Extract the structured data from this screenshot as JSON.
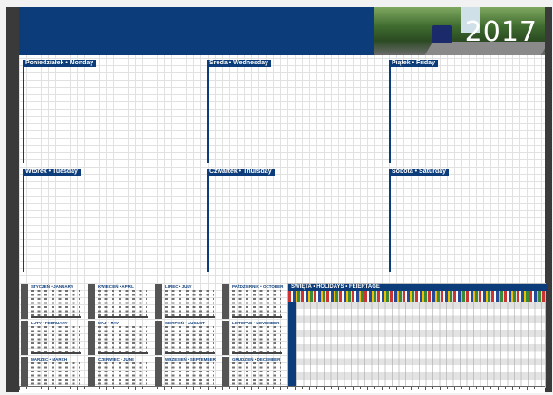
{
  "year": "2017",
  "days": {
    "mon": "Poniedziałek • Monday",
    "wed": "Środa • Wednesday",
    "fri": "Piątek • Friday",
    "tue": "Wtorek • Tuesday",
    "thu": "Czwartek • Thursday",
    "sat": "Sobota • Saturday"
  },
  "months": [
    "STYCZEŃ • JANUARY",
    "KWIECIEŃ • APRIL",
    "LIPIEC • JULY",
    "PAŹDZIERNIK • OCTOBER",
    "LUTY • FEBRUARY",
    "MAJ • MAY",
    "SIERPIEŃ • AUGUST",
    "LISTOPAD • NOVEMBER",
    "MARZEC • MARCH",
    "CZERWIEC • JUNE",
    "WRZESIEŃ • SEPTEMBER",
    "GRUDZIEŃ • DECEMBER"
  ],
  "holidays_title": "ŚWIĘTA • HOLIDAYS • FEIERTAGE"
}
